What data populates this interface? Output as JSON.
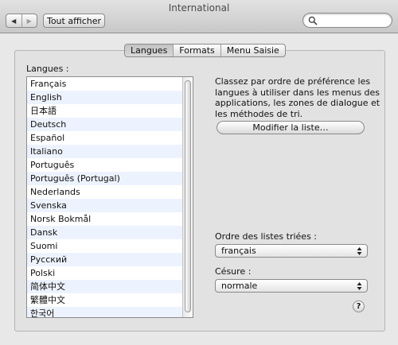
{
  "window": {
    "title": "International"
  },
  "toolbar": {
    "show_all_label": "Tout afficher",
    "search_value": ""
  },
  "tabs": [
    {
      "label": "Langues",
      "active": true
    },
    {
      "label": "Formats",
      "active": false
    },
    {
      "label": "Menu Saisie",
      "active": false
    }
  ],
  "languages": {
    "label": "Langues :",
    "items": [
      "Français",
      "English",
      "日本語",
      "Deutsch",
      "Español",
      "Italiano",
      "Português",
      "Português (Portugal)",
      "Nederlands",
      "Svenska",
      "Norsk Bokmål",
      "Dansk",
      "Suomi",
      "Русский",
      "Polski",
      "简体中文",
      "繁體中文",
      "한국어"
    ]
  },
  "description": "Classez par ordre de préférence les langues à utiliser dans les menus des applications, les zones de dialogue et les méthodes de tri.",
  "edit_list_button": "Modifier la liste…",
  "sort_order": {
    "label": "Ordre des listes triées :",
    "value": "français"
  },
  "hyphenation": {
    "label": "Césure :",
    "value": "normale"
  },
  "help": "?"
}
